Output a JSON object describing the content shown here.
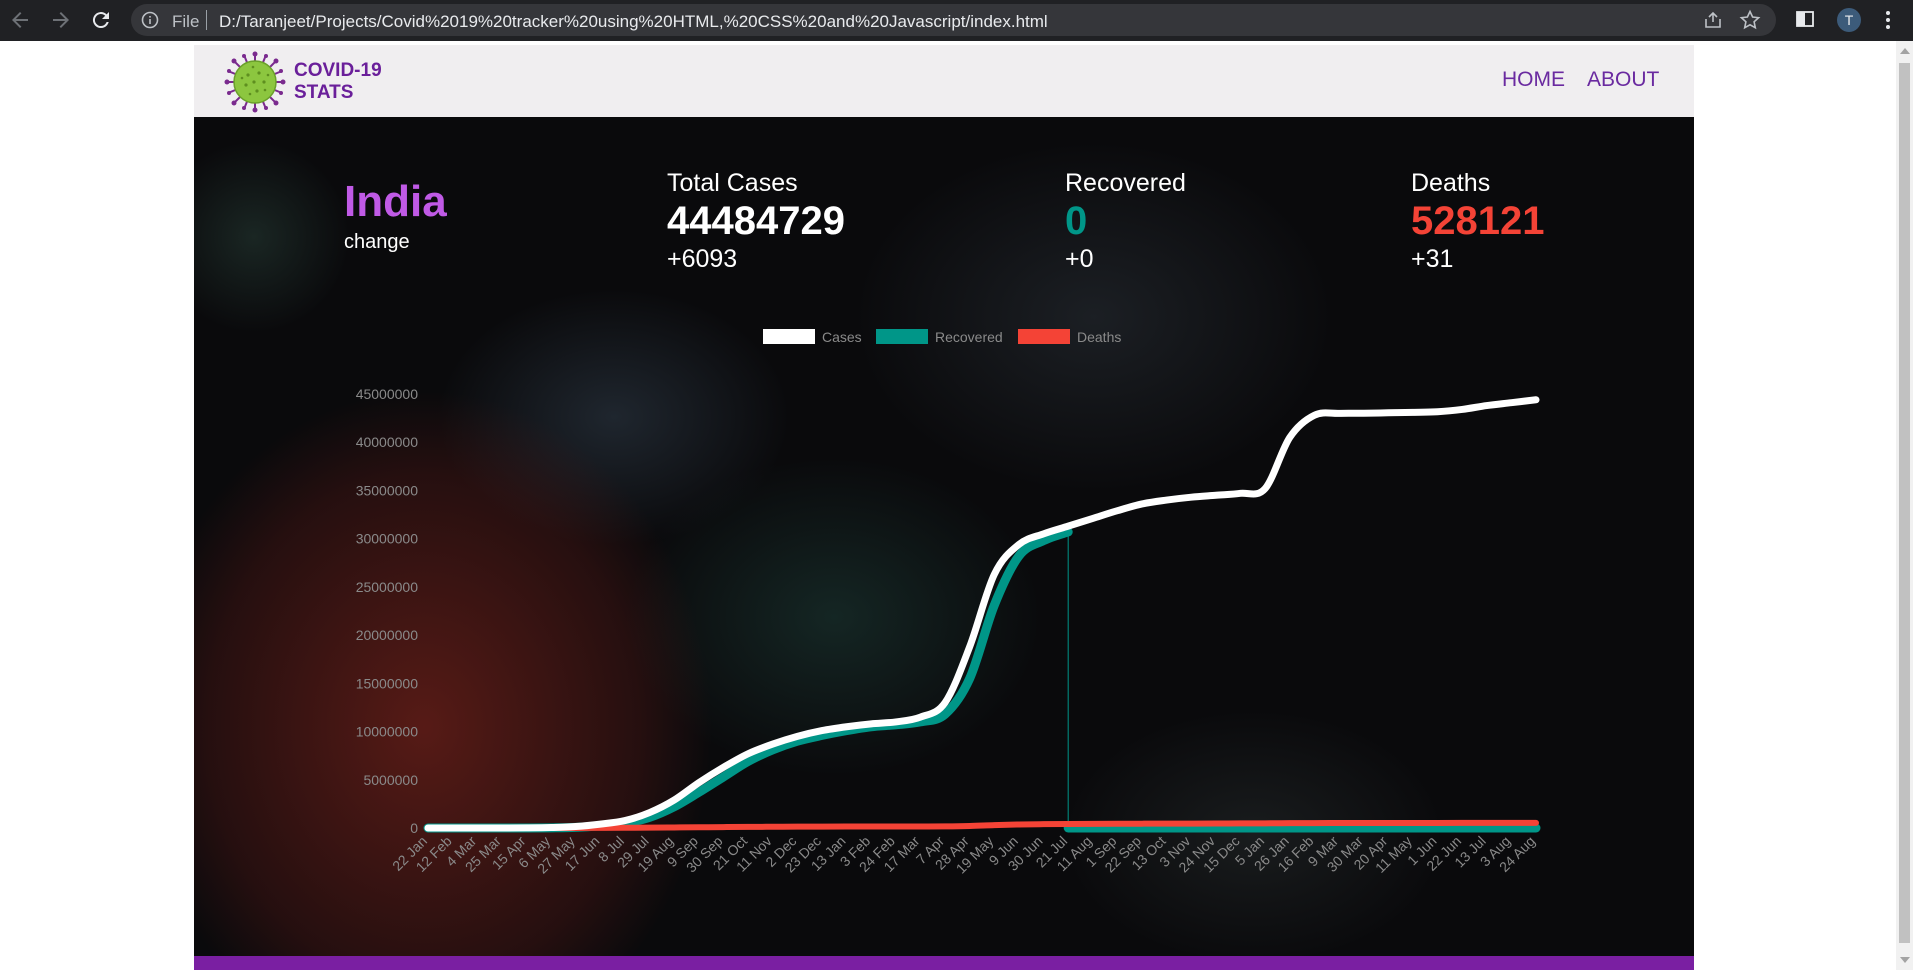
{
  "browser": {
    "scheme": "File",
    "url": "D:/Taranjeet/Projects/Covid%2019%20tracker%20using%20HTML,%20CSS%20and%20Javascript/index.html",
    "avatar_letter": "T"
  },
  "header": {
    "brand_line1": "COVID-19",
    "brand_line2": "STATS",
    "nav": [
      {
        "label": "HOME"
      },
      {
        "label": "ABOUT"
      }
    ]
  },
  "stats": {
    "country": "India",
    "change_label": "change",
    "total": {
      "title": "Total Cases",
      "value": "44484729",
      "delta": "+6093"
    },
    "recovered": {
      "title": "Recovered",
      "value": "0",
      "delta": "+0"
    },
    "deaths": {
      "title": "Deaths",
      "value": "528121",
      "delta": "+31"
    }
  },
  "colors": {
    "accent": "#6a1f9a",
    "country": "#c05ae6",
    "cases": "#ffffff",
    "recovered": "#009688",
    "deaths": "#f44336",
    "footer": "#7a1fa2"
  },
  "chart_data": {
    "type": "line",
    "legend": [
      "Cases",
      "Recovered",
      "Deaths"
    ],
    "legend_position": "top",
    "ylim": [
      0,
      45000000
    ],
    "yticks": [
      0,
      5000000,
      10000000,
      15000000,
      20000000,
      25000000,
      30000000,
      35000000,
      40000000,
      45000000
    ],
    "x": [
      "22 Jan",
      "12 Feb",
      "4 Mar",
      "25 Mar",
      "15 Apr",
      "6 May",
      "27 May",
      "17 Jun",
      "8 Jul",
      "29 Jul",
      "19 Aug",
      "9 Sep",
      "30 Sep",
      "21 Oct",
      "11 Nov",
      "2 Dec",
      "23 Dec",
      "13 Jan",
      "3 Feb",
      "24 Feb",
      "17 Mar",
      "7 Apr",
      "28 Apr",
      "19 May",
      "9 Jun",
      "30 Jun",
      "21 Jul",
      "11 Aug",
      "1 Sep",
      "22 Sep",
      "13 Oct",
      "3 Nov",
      "24 Nov",
      "15 Dec",
      "5 Jan",
      "26 Jan",
      "16 Feb",
      "9 Mar",
      "30 Mar",
      "20 Apr",
      "11 May",
      "1 Jun",
      "22 Jun",
      "13 Jul",
      "3 Aug",
      "24 Aug"
    ],
    "series": [
      {
        "name": "Cases",
        "color": "#ffffff",
        "values": [
          0,
          3,
          5,
          700,
          12000,
          50000,
          150000,
          400000,
          770000,
          1600000,
          2900000,
          4700000,
          6300000,
          7700000,
          8700000,
          9500000,
          10100000,
          10500000,
          10800000,
          11000000,
          11500000,
          13000000,
          18800000,
          26300000,
          29400000,
          30500000,
          31300000,
          32100000,
          32900000,
          33600000,
          34000000,
          34300000,
          34500000,
          34700000,
          35200000,
          40500000,
          42800000,
          42990000,
          43000000,
          43050000,
          43100000,
          43160000,
          43400000,
          43800000,
          44100000,
          44400000
        ]
      },
      {
        "name": "Recovered",
        "color": "#009688",
        "values": [
          0,
          0,
          0,
          50,
          2000,
          16000,
          65000,
          230000,
          500000,
          1100000,
          2200000,
          3700000,
          5300000,
          6900000,
          8100000,
          9000000,
          9600000,
          10100000,
          10500000,
          10700000,
          11000000,
          11800000,
          15500000,
          23100000,
          28200000,
          29800000,
          30700000,
          0,
          0,
          0,
          0,
          0,
          0,
          0,
          0,
          0,
          0,
          0,
          0,
          0,
          0,
          0,
          0,
          0,
          0,
          0
        ]
      },
      {
        "name": "Deaths",
        "color": "#f44336",
        "values": [
          0,
          0,
          0,
          20,
          400,
          1700,
          4200,
          12000,
          21000,
          35000,
          55000,
          75000,
          97000,
          116000,
          127000,
          139000,
          147000,
          152000,
          155000,
          157000,
          160000,
          167000,
          208000,
          300000,
          365000,
          398000,
          420000,
          433000,
          439000,
          447000,
          451000,
          456000,
          463000,
          477000,
          483000,
          500000,
          510000,
          515000,
          521000,
          522000,
          524000,
          524500,
          525000,
          526000,
          527000,
          528121
        ]
      }
    ]
  }
}
